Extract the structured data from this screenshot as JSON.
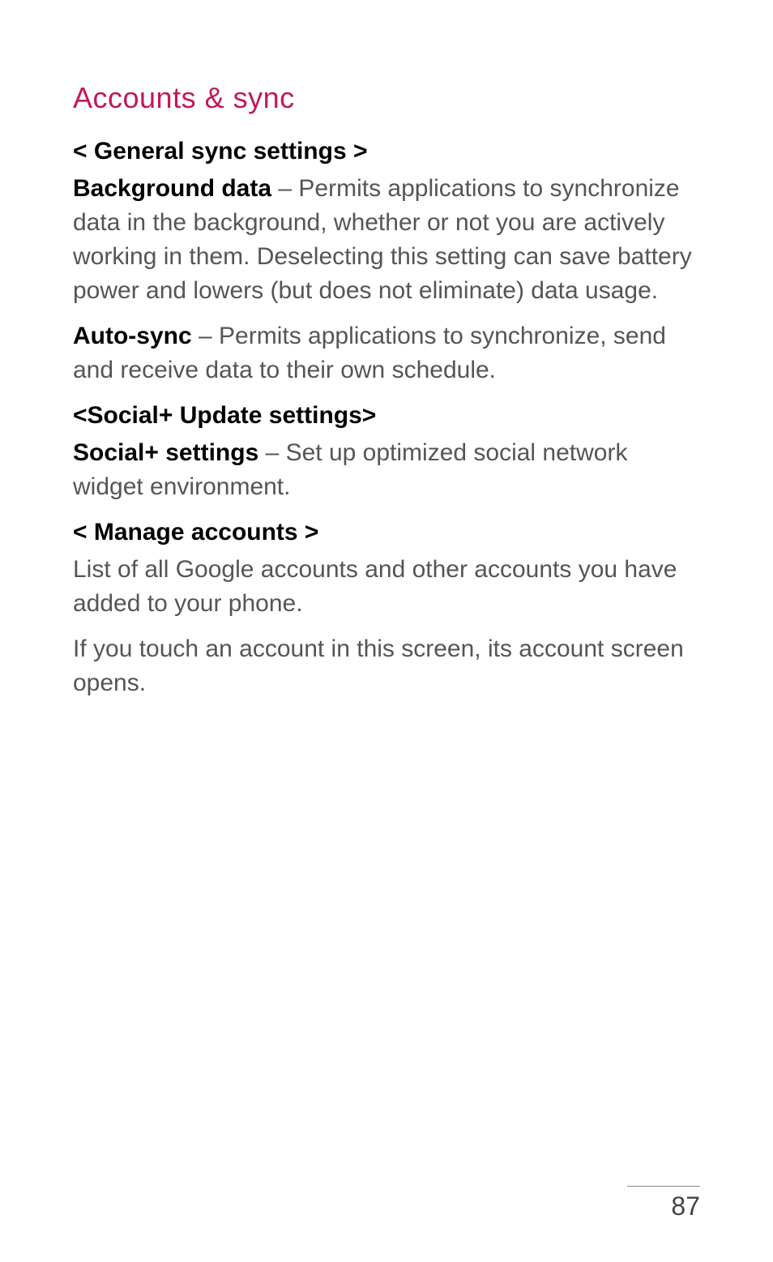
{
  "title": "Accounts & sync",
  "sections": [
    {
      "heading": "< General sync settings >",
      "paragraphs": [
        {
          "bold": "Background data",
          "text": " – Permits applications to synchronize data in the background, whether or not you are actively working in them. Deselecting this setting can save battery power and lowers (but does not eliminate) data usage."
        },
        {
          "bold": "Auto-sync",
          "text": " – Permits applications to synchronize, send and receive data to their own schedule."
        }
      ]
    },
    {
      "heading": "<Social+ Update settings>",
      "paragraphs": [
        {
          "bold": "Social+ settings",
          "text": " – Set up optimized social network widget environment."
        }
      ]
    },
    {
      "heading": "< Manage accounts >",
      "paragraphs": [
        {
          "bold": "",
          "text": "List of all Google accounts and other accounts you have added to your phone."
        },
        {
          "bold": "",
          "text": "If you touch an account in this screen, its account screen opens."
        }
      ]
    }
  ],
  "page_number": "87"
}
